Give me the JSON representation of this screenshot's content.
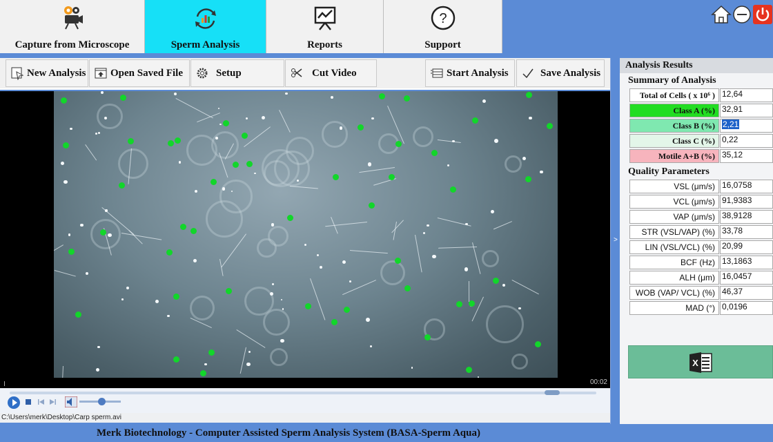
{
  "nav": {
    "tabs": [
      {
        "label": "Capture from Microscope",
        "icon": "camera-icon"
      },
      {
        "label": "Sperm Analysis",
        "icon": "analysis-icon",
        "active": true
      },
      {
        "label": "Reports",
        "icon": "report-chart-icon"
      },
      {
        "label": "Support",
        "icon": "question-icon"
      }
    ],
    "window_controls": [
      "home-icon",
      "minimize-icon",
      "power-icon"
    ]
  },
  "toolbar": {
    "new_analysis": "New Analysis",
    "open_saved_file": "Open Saved File",
    "setup": "Setup",
    "cut_video": "Cut Video",
    "start_analysis": "Start Analysis",
    "save_analysis": "Save Analysis"
  },
  "video": {
    "timecode": "00:02",
    "file_path": "C:\\Users\\merk\\Desktop\\Carp sperm.avi"
  },
  "results": {
    "title": "Analysis Results",
    "summary_title": "Summary of Analysis",
    "summary": [
      {
        "label": "Total of Cells ( x 10⁶ )",
        "value": "12,64"
      },
      {
        "label": "Class A  (%)",
        "value": "32,91"
      },
      {
        "label": "Class B (%)",
        "value": "2,21"
      },
      {
        "label": "Class C (%)",
        "value": "0,22"
      },
      {
        "label": "Motile A+B (%)",
        "value": "35,12"
      }
    ],
    "quality_title": "Quality Parameters",
    "quality": [
      {
        "label": "VSL  (μm/s)",
        "value": "16,0758"
      },
      {
        "label": "VCL  (μm/s)",
        "value": "91,9383"
      },
      {
        "label": "VAP  (μm/s)",
        "value": "38,9128"
      },
      {
        "label": "STR (VSL/VAP) (%)",
        "value": "33,78"
      },
      {
        "label": "LIN (VSL/VCL) (%)",
        "value": "20,99"
      },
      {
        "label": "BCF (Hz)",
        "value": "13,1863"
      },
      {
        "label": "ALH (μm)",
        "value": "16,0457"
      },
      {
        "label": "WOB (VAP/ VCL) (%)",
        "value": "46,37"
      },
      {
        "label": "MAD  (°)",
        "value": "0,0196"
      }
    ]
  },
  "colors": {
    "class_a": "#22dd22",
    "class_b": "#7fe8b0",
    "class_c": "#e3f6e9",
    "motile": "#f7b4bd",
    "active_tab": "#16e0f7",
    "chrome": "#5b8bd6",
    "excel": "#6bbd98"
  },
  "footer": {
    "text": "Merk Biotechnology - Computer Assisted Sperm Analysis System (BASA-Sperm Aqua)"
  }
}
